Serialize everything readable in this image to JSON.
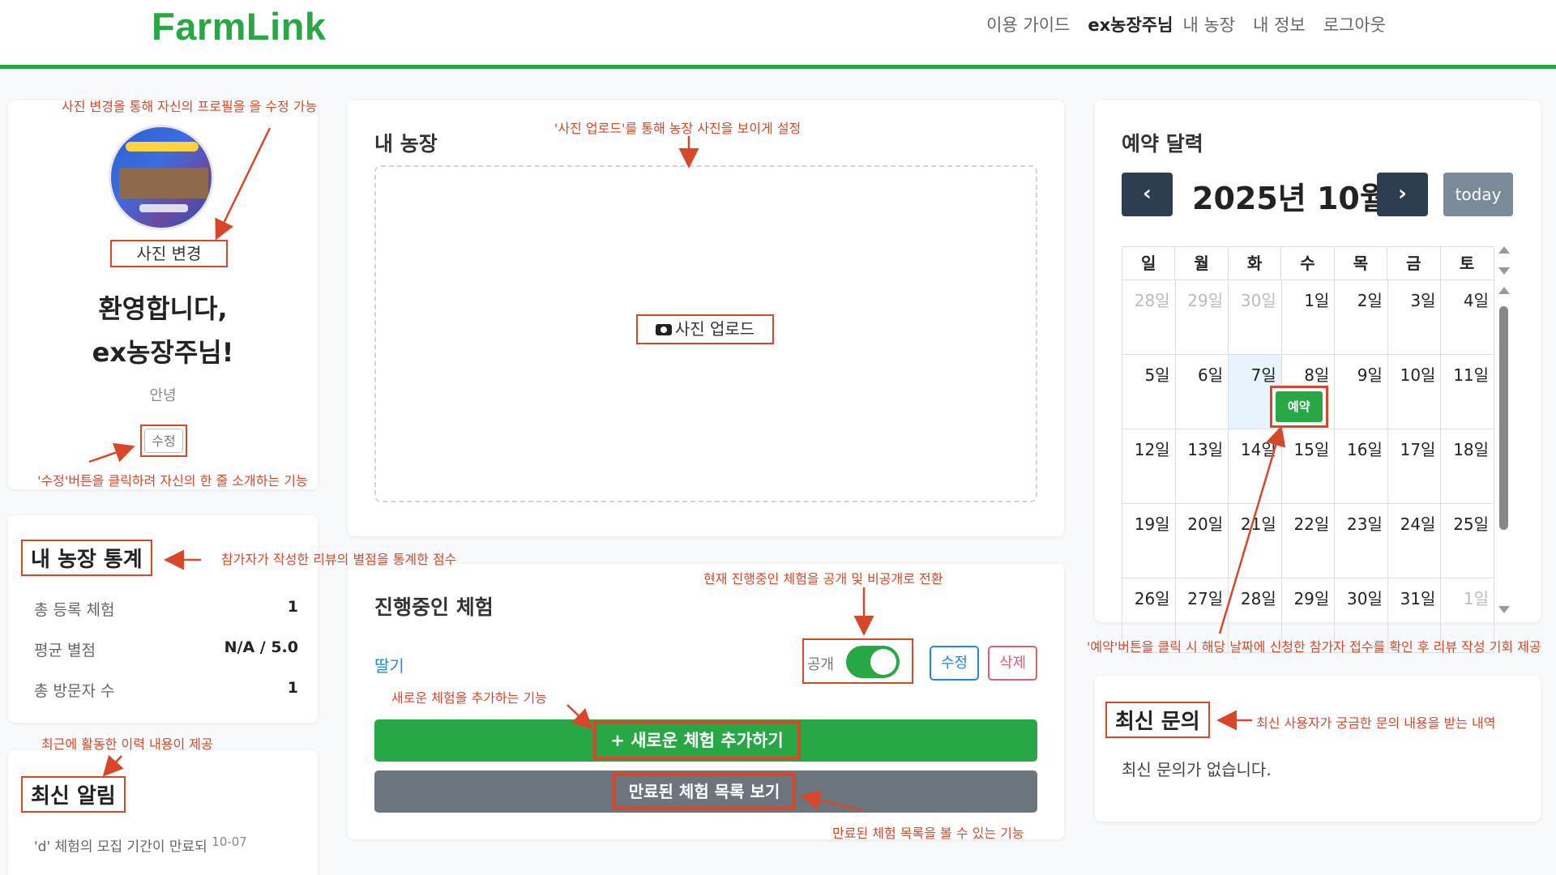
{
  "header": {
    "logo": "FarmLink",
    "nav": [
      "이용 가이드",
      "ex농장주님",
      "내 농장",
      "내 정보",
      "로그아웃"
    ]
  },
  "profile": {
    "photo_change": "사진 변경",
    "welcome_line1": "환영합니다,",
    "welcome_line2": "ex농장주님!",
    "bio": "안녕",
    "edit": "수정"
  },
  "stats": {
    "title": "내 농장 통계",
    "rows": [
      {
        "label": "총 등록 체험",
        "value": "1"
      },
      {
        "label": "평균 별점",
        "value": "N/A / 5.0"
      },
      {
        "label": "총 방문자 수",
        "value": "1"
      }
    ]
  },
  "notice": {
    "title": "최신 알림",
    "item_text": "'d' 체험의 모집 기간이 만료되",
    "item_date": "10-07"
  },
  "farm": {
    "title": "내 농장",
    "upload": "사진 업로드"
  },
  "experience": {
    "title": "진행중인 체험",
    "name": "딸기",
    "public_label": "공개",
    "edit": "수정",
    "delete": "삭제",
    "add": "+ 새로운 체험 추가하기",
    "expired": "만료된 체험 목록 보기"
  },
  "calendar": {
    "title": "예약 달력",
    "month": "2025년 10월",
    "prev": "‹",
    "next": "›",
    "today": "today",
    "weekdays": [
      "일",
      "월",
      "화",
      "수",
      "목",
      "금",
      "토"
    ],
    "weeks": [
      [
        "28일",
        "29일",
        "30일",
        "1일",
        "2일",
        "3일",
        "4일"
      ],
      [
        "5일",
        "6일",
        "7일",
        "8일",
        "9일",
        "10일",
        "11일"
      ],
      [
        "12일",
        "13일",
        "14일",
        "15일",
        "16일",
        "17일",
        "18일"
      ],
      [
        "19일",
        "20일",
        "21일",
        "22일",
        "23일",
        "24일",
        "25일"
      ],
      [
        "26일",
        "27일",
        "28일",
        "29일",
        "30일",
        "31일",
        "1일"
      ]
    ],
    "event_label": "예약"
  },
  "inquiry": {
    "title": "최신 문의",
    "empty": "최신 문의가 없습니다."
  },
  "annotations": {
    "photo": "사진 변경을 통해 자신의 프로필을 을 수정 가능",
    "upload": "'사진 업로드'를 통해  농장 사진을 보이게 설정",
    "edit_bio": "'수정'버튼을 클릭하려 자신의 한 줄 소개하는 기능",
    "stats": "참가자가 작성한 리뷰의 별점을 통계한 점수",
    "toggle": "현재 진행중인 체험을 공개 및 비공개로 전환",
    "add": "새로운 체험을 추가하는 기능",
    "notice": "최근에 활동한 이력 내용이 제공",
    "expired": "만료된 체험 목록을 볼 수 있는 기능",
    "reserve": "'예약'버튼을 클릭 시 해당 날짜에 신청한 참가자 접수를 확인 후 리뷰 작성 기회 제공",
    "inquiry": "최신 사용자가 궁금한 문의 내용을 받는 내역"
  },
  "colors": {
    "brand": "#28a745",
    "annotation": "#d9472b",
    "link": "#1e88e5",
    "dark": "#2c3e50"
  }
}
